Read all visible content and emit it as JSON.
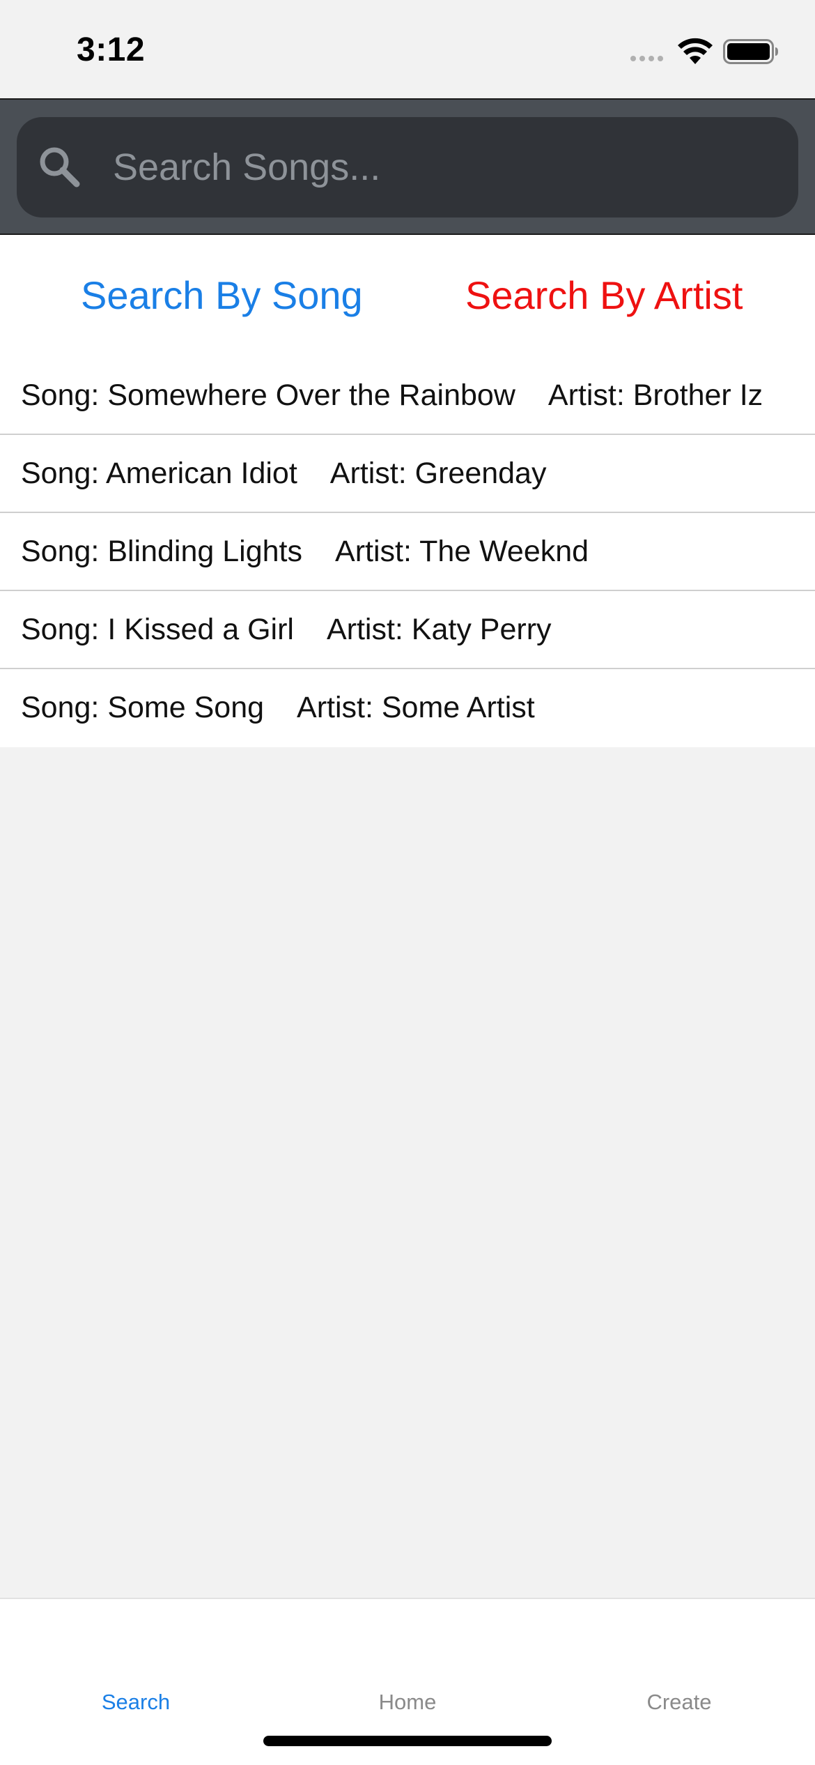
{
  "status_bar": {
    "time": "3:12"
  },
  "search": {
    "placeholder": "Search Songs...",
    "value": ""
  },
  "modes": {
    "song_label": "Search By Song",
    "artist_label": "Search By Artist",
    "song_color": "#1a7fe6",
    "artist_color": "#ee1111"
  },
  "results": [
    {
      "song": "Song: Somewhere Over the Rainbow",
      "artist": "Artist: Brother Iz"
    },
    {
      "song": "Song: American Idiot",
      "artist": "Artist: Greenday"
    },
    {
      "song": "Song: Blinding Lights",
      "artist": "Artist: The Weeknd"
    },
    {
      "song": "Song: I Kissed a Girl",
      "artist": "Artist: Katy Perry"
    },
    {
      "song": "Song: Some Song",
      "artist": "Artist: Some Artist"
    }
  ],
  "tabs": {
    "search": "Search",
    "home": "Home",
    "create": "Create",
    "active": "Search"
  },
  "icons": {
    "search": "search-icon",
    "wifi": "wifi-icon",
    "battery": "battery-icon",
    "signal": "signal-dots-icon"
  }
}
